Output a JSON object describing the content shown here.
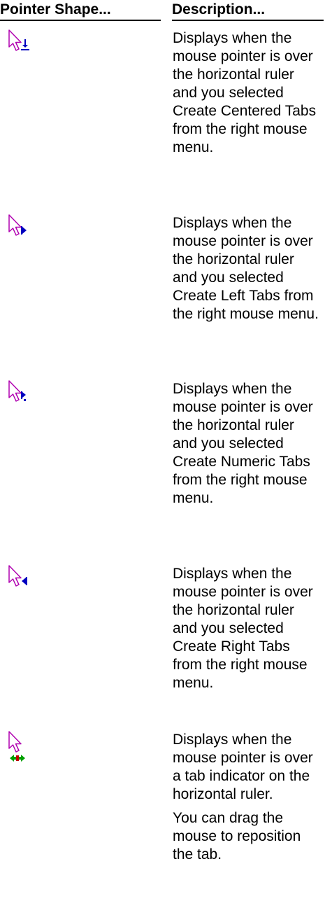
{
  "header": {
    "pointer_shape": "Pointer Shape...",
    "description": "Description..."
  },
  "rows": [
    {
      "icon": "pointer-center-tab-icon",
      "description": "Displays when the mouse pointer is over the horizontal ruler and you selected Create Centered Tabs from the right mouse menu."
    },
    {
      "icon": "pointer-left-tab-icon",
      "description": "Displays when the mouse pointer is over the horizontal ruler and you selected Create Left Tabs from the right mouse menu."
    },
    {
      "icon": "pointer-numeric-tab-icon",
      "description": "Displays when the mouse pointer is over the horizontal ruler and you selected Create Numeric Tabs from the right mouse menu."
    },
    {
      "icon": "pointer-right-tab-icon",
      "description": "Displays when the mouse pointer is over the horizontal ruler and you selected Create Right Tabs from the right mouse menu."
    },
    {
      "icon": "pointer-move-tab-icon",
      "description": "Displays when the mouse pointer is over a tab indicator on the horizontal ruler.",
      "description_2": "You can drag the mouse to reposition the tab."
    }
  ],
  "colors": {
    "arrow_outline": "#b000b0",
    "tab_blue": "#0000c0",
    "move_green": "#00a000",
    "move_red": "#c00000"
  }
}
